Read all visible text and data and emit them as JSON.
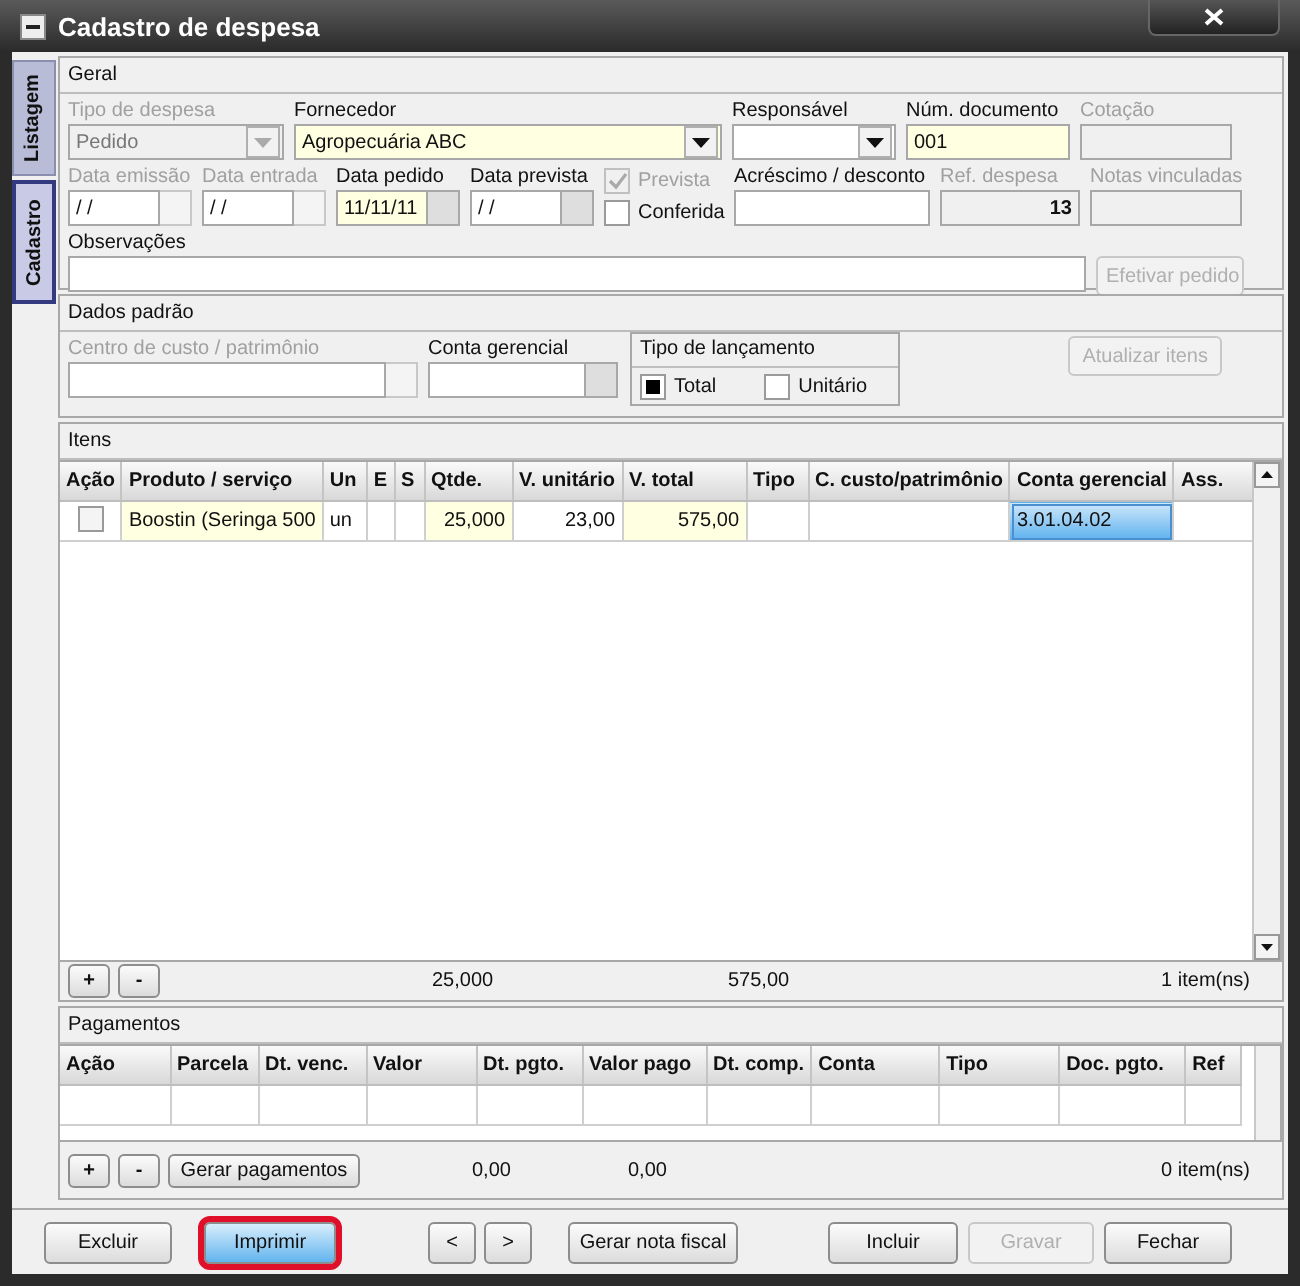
{
  "window": {
    "title": "Cadastro de despesa"
  },
  "side_tabs": [
    {
      "label": "Listagem",
      "selected": false
    },
    {
      "label": "Cadastro",
      "selected": true
    }
  ],
  "geral": {
    "title": "Geral",
    "row1": [
      {
        "kind": "combo",
        "label": "Tipo de despesa",
        "value": "Pedido",
        "disabled": true,
        "required": true
      },
      {
        "kind": "combo",
        "label": "Fornecedor",
        "value": "Agropecuária ABC",
        "disabled": false,
        "required": true
      },
      {
        "kind": "combo",
        "label": "Responsável",
        "disabled": false,
        "required": false
      },
      {
        "kind": "text",
        "label": "Núm. documento",
        "value": "001",
        "disabled": false,
        "required": true
      },
      {
        "kind": "text",
        "label": "Cotação",
        "disabled": true,
        "required": false
      }
    ],
    "row2": [
      {
        "kind": "picker",
        "label": "Data emissão",
        "value": " / /",
        "disabled": true,
        "required": false
      },
      {
        "kind": "picker",
        "label": "Data entrada",
        "value": " / /",
        "disabled": true,
        "required": false
      },
      {
        "kind": "picker",
        "label": "Data pedido",
        "value": "11/11/11",
        "disabled": false,
        "required": true
      },
      {
        "kind": "picker",
        "label": "Data prevista",
        "value": " / /",
        "disabled": false,
        "required": false
      },
      {
        "kind": "checks",
        "items": [
          {
            "label": "Prevista",
            "checked": true,
            "disabled": true
          },
          {
            "label": "Conferida",
            "checked": false,
            "disabled": false
          }
        ]
      },
      {
        "kind": "text",
        "label": "Acréscimo / desconto",
        "disabled": false,
        "required": false
      },
      {
        "kind": "number",
        "label": "Ref. despesa",
        "value": "13",
        "disabled": true,
        "required": false
      },
      {
        "kind": "text",
        "label": "Notas vinculadas",
        "disabled": true,
        "required": false
      }
    ],
    "row3": [
      {
        "kind": "text",
        "label": "Observações",
        "disabled": false,
        "required": false
      },
      {
        "kind": "button",
        "label": "Efetivar pedido",
        "disabled": true
      }
    ]
  },
  "dados_padrao": {
    "title": "Dados padrão",
    "fields": [
      {
        "kind": "picker",
        "label": "Centro de custo / patrimônio",
        "disabled": true,
        "required": false
      },
      {
        "kind": "picker",
        "label": "Conta gerencial",
        "disabled": false,
        "required": false
      }
    ],
    "tipo_lancamento": {
      "title": "Tipo de lançamento",
      "options": [
        {
          "label": "Total",
          "selected": true
        },
        {
          "label": "Unitário",
          "selected": false
        }
      ]
    },
    "button": {
      "label": "Atualizar itens",
      "disabled": true
    }
  },
  "itens": {
    "title": "Itens",
    "columns": [
      "Ação",
      "Produto / serviço",
      "Un",
      "E",
      "S",
      "Qtde.",
      "V. unitário",
      "V. total",
      "Tipo",
      "C. custo/patrimônio",
      "Conta gerencial",
      "Ass."
    ],
    "rows": [
      {
        "cells": [
          {
            "kind": "checkbox",
            "checked": false
          },
          {
            "kind": "text",
            "text": "Boostin (Seringa 500",
            "required": true,
            "selected": false
          },
          {
            "kind": "text",
            "text": "un",
            "required": false,
            "selected": false
          },
          {
            "kind": "text",
            "required": false,
            "selected": false
          },
          {
            "kind": "text",
            "required": false,
            "selected": false
          },
          {
            "kind": "number",
            "text": "25,000",
            "required": true,
            "selected": false
          },
          {
            "kind": "number",
            "text": "23,00",
            "required": false,
            "selected": false
          },
          {
            "kind": "number",
            "text": "575,00",
            "required": true,
            "selected": false
          },
          {
            "kind": "text",
            "required": false,
            "selected": false
          },
          {
            "kind": "text",
            "required": false,
            "selected": false
          },
          {
            "kind": "text",
            "text": "3.01.04.02",
            "required": false,
            "selected": true
          },
          {
            "kind": "text",
            "required": false,
            "selected": false
          }
        ]
      }
    ],
    "add_button": "+",
    "remove_button": "-",
    "total_qtde": "25,000",
    "total_valor": "575,00",
    "count": "1 item(ns)"
  },
  "pagamentos": {
    "title": "Pagamentos",
    "columns": [
      "Ação",
      "Parcela",
      "Dt. venc.",
      "Valor",
      "Dt. pgto.",
      "Valor pago",
      "Dt. comp.",
      "Conta",
      "Tipo",
      "Doc. pgto.",
      "Ref"
    ],
    "add_button": "+",
    "remove_button": "-",
    "generate_button": "Gerar pagamentos",
    "total_valor": "0,00",
    "total_pago": "0,00",
    "count": "0 item(ns)"
  },
  "buttons": [
    {
      "label": "Excluir",
      "disabled": false,
      "highlighted": false
    },
    {
      "label": "Imprimir",
      "disabled": false,
      "highlighted": true
    },
    {
      "label": "<",
      "disabled": false,
      "highlighted": false
    },
    {
      "label": ">",
      "disabled": false,
      "highlighted": false
    },
    {
      "label": "Gerar nota fiscal",
      "disabled": false,
      "highlighted": false
    },
    {
      "label": "Incluir",
      "disabled": false,
      "highlighted": false
    },
    {
      "label": "Gravar",
      "disabled": true,
      "highlighted": false
    },
    {
      "label": "Fechar",
      "disabled": false,
      "highlighted": false
    }
  ]
}
